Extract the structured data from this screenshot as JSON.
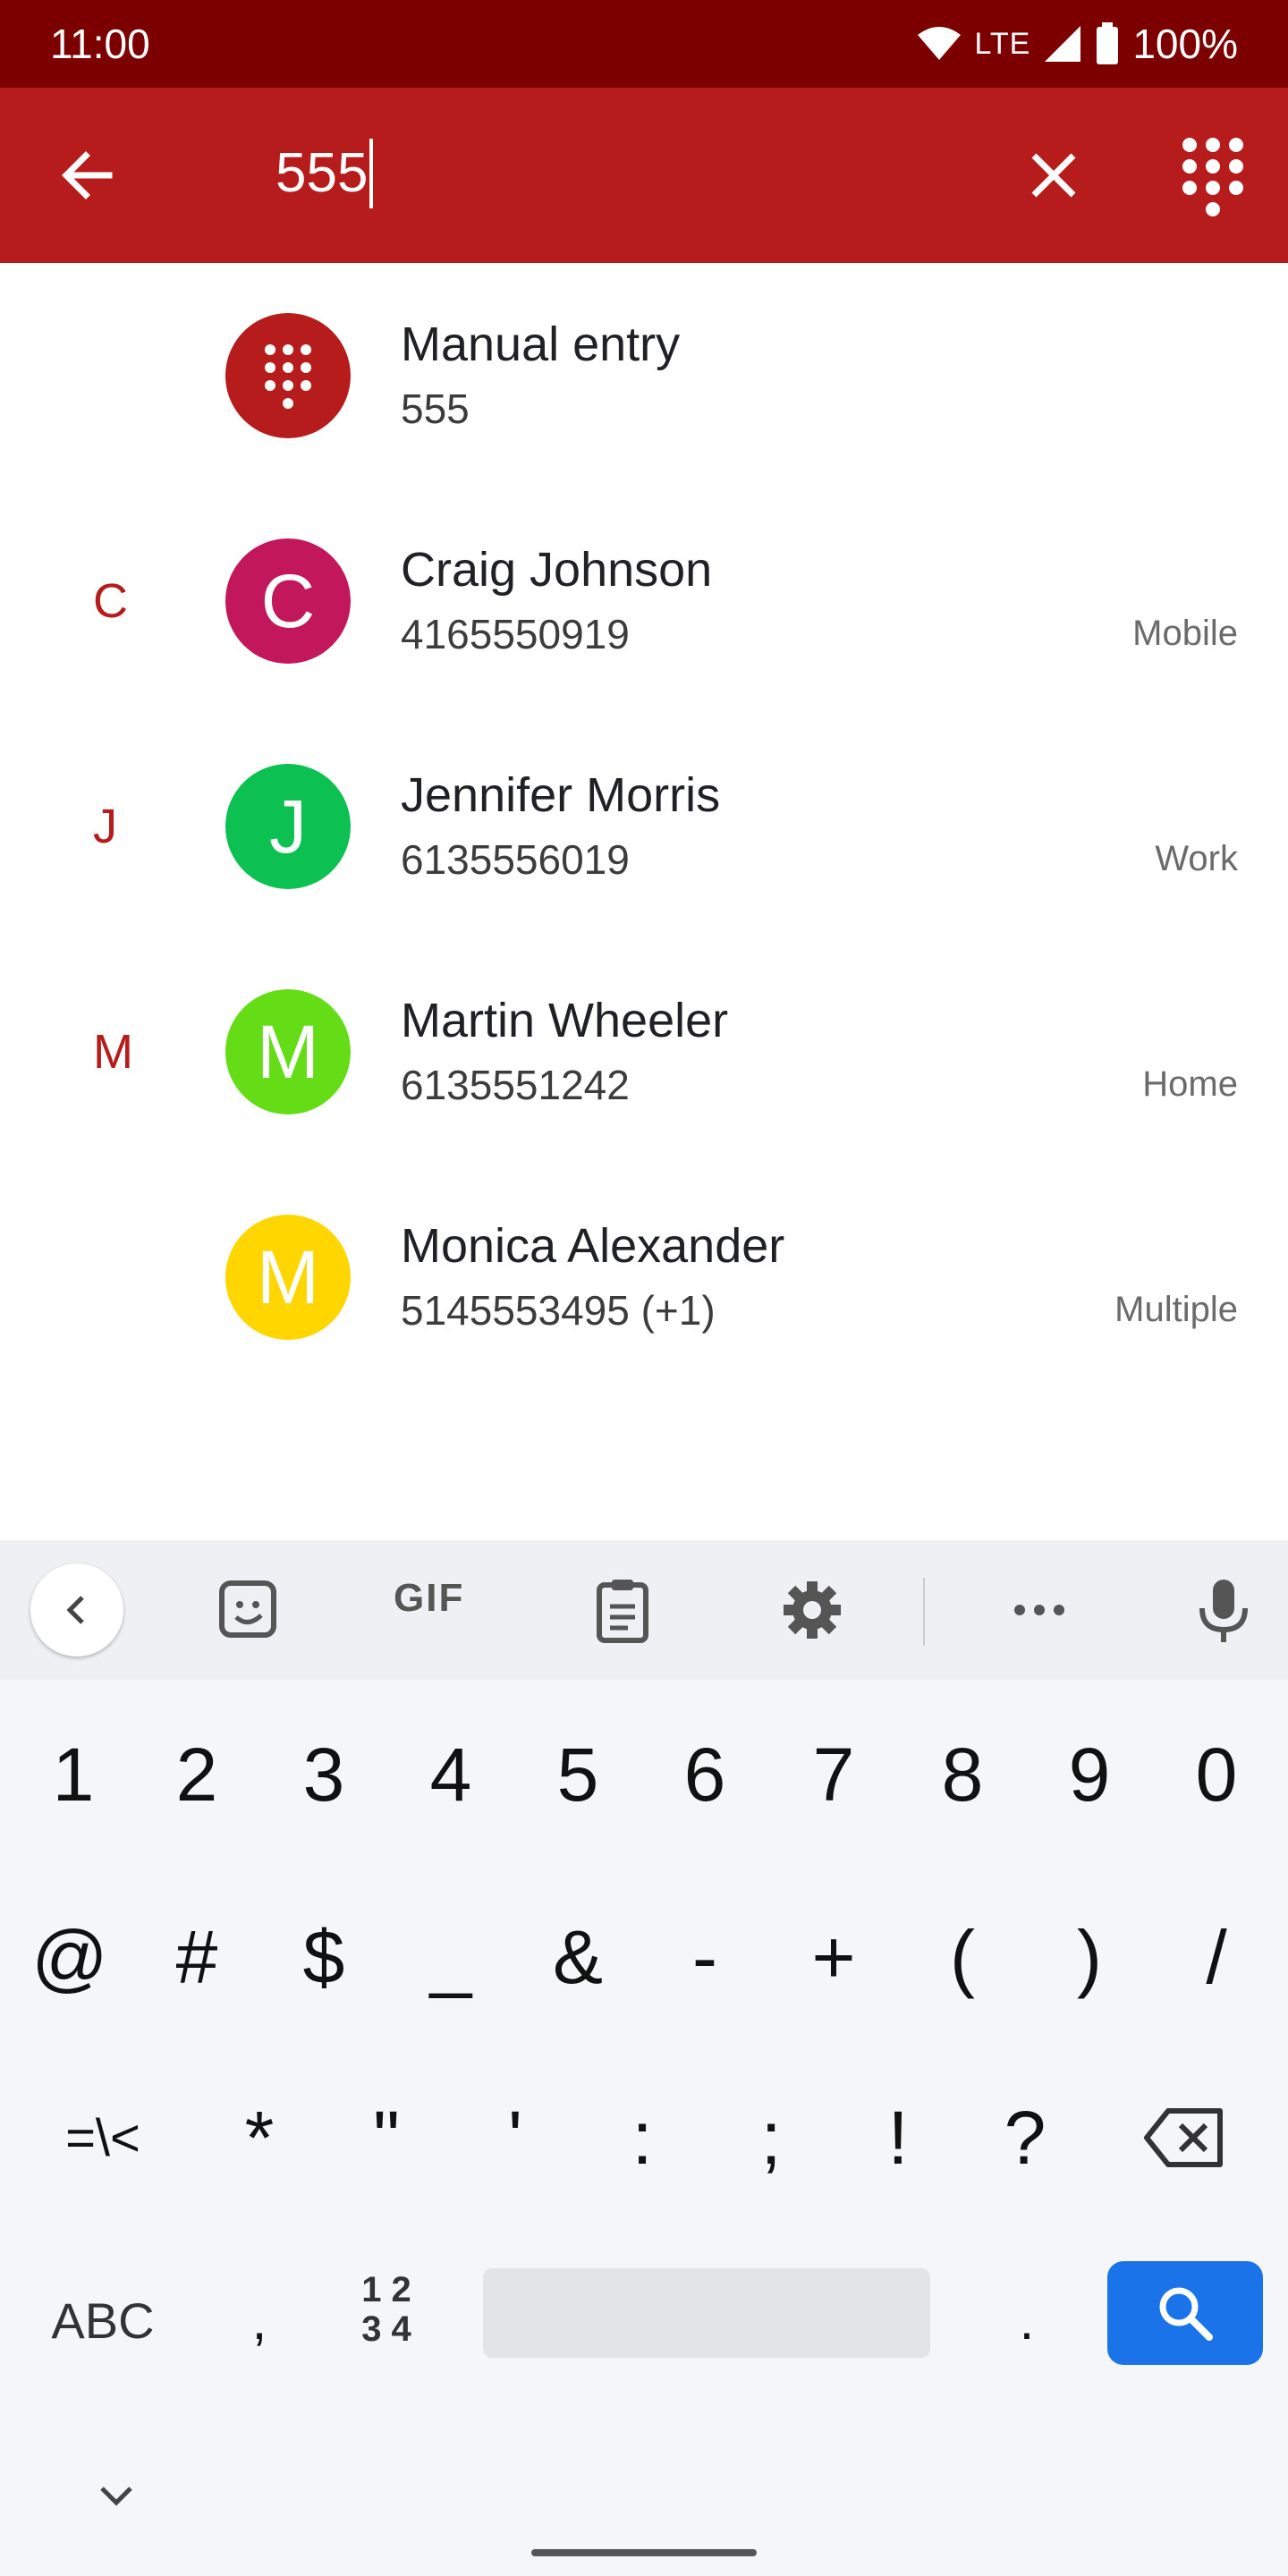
{
  "status_bar": {
    "time": "11:00",
    "network": "LTE",
    "battery": "100%"
  },
  "search": {
    "query": "555"
  },
  "results": [
    {
      "letter": "",
      "avatar_letter": "",
      "avatar_color": "#b71c1c",
      "name": "Manual entry",
      "number": "555",
      "type": ""
    },
    {
      "letter": "C",
      "avatar_letter": "C",
      "avatar_color": "#c2185b",
      "name": "Craig Johnson",
      "number": "4165550919",
      "type": "Mobile"
    },
    {
      "letter": "J",
      "avatar_letter": "J",
      "avatar_color": "#0cc152",
      "name": "Jennifer Morris",
      "number": "6135556019",
      "type": "Work"
    },
    {
      "letter": "M",
      "avatar_letter": "M",
      "avatar_color": "#64dd17",
      "name": "Martin Wheeler",
      "number": "6135551242",
      "type": "Home"
    },
    {
      "letter": "",
      "avatar_letter": "M",
      "avatar_color": "#ffd600",
      "name": "Monica Alexander",
      "number": "5145553495 (+1)",
      "type": "Multiple"
    }
  ],
  "keyboard": {
    "toolbar": {
      "gif_label": "GIF"
    },
    "row1": [
      "1",
      "2",
      "3",
      "4",
      "5",
      "6",
      "7",
      "8",
      "9",
      "0"
    ],
    "row2": [
      "@",
      "#",
      "$",
      "_",
      "&",
      "-",
      "+",
      "(",
      ")",
      "/"
    ],
    "row3": [
      "=\\<",
      "*",
      "\"",
      "'",
      ":",
      ";",
      "!",
      "?"
    ],
    "row4": {
      "abc": "ABC",
      "comma": ",",
      "numpad_top": "1 2",
      "numpad_bottom": "3 4",
      "period": "."
    }
  },
  "colors": {
    "status_bar": "#7d0000",
    "app_bar": "#b71c1c",
    "accent": "#b71c1c",
    "search_key": "#1a73e8"
  }
}
